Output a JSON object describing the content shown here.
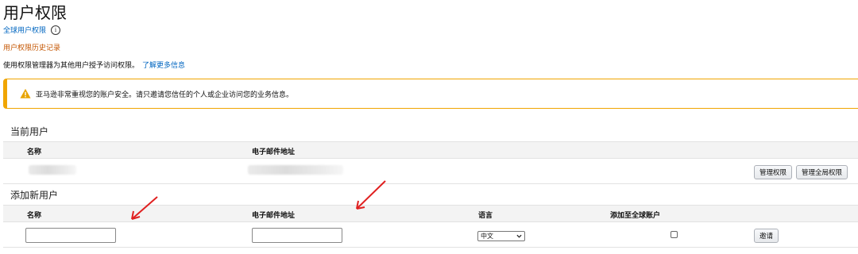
{
  "page": {
    "title": "用户权限",
    "global_permissions_link": "全球用户权限",
    "history_link": "用户权限历史记录",
    "description": "使用权限管理器为其他用户授予访问权限。",
    "learn_more": "了解更多信息"
  },
  "alert": {
    "message": "亚马逊非常重视您的账户安全。请只邀请您信任的个人或企业访问您的业务信息。",
    "color": "#f0a500"
  },
  "current_users": {
    "section_title": "当前用户",
    "columns": [
      "名称",
      "电子邮件地址"
    ],
    "rows": [
      {
        "manage_permissions": "管理权限",
        "manage_global_permissions": "管理全局权限"
      }
    ]
  },
  "add_user": {
    "section_title": "添加新用户",
    "columns": [
      "名称",
      "电子邮件地址",
      "语言",
      "添加至全球账户"
    ],
    "name_value": "",
    "email_value": "",
    "language_selected": "中文",
    "add_global_checked": false,
    "invite_button": "邀请"
  },
  "colors": {
    "link": "#0066c0",
    "history_link": "#c45500",
    "annotation_arrow": "#e02020"
  }
}
